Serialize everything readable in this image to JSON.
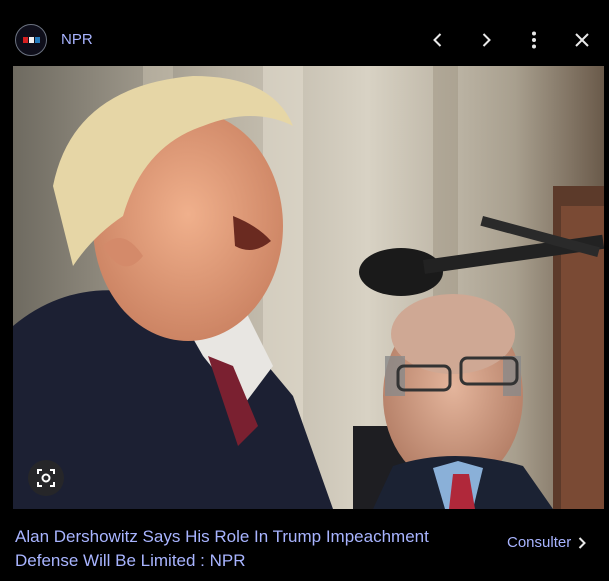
{
  "header": {
    "site_name": "NPR",
    "logo_colors": [
      "#d62021",
      "#2f2f2f",
      "#237bbd"
    ]
  },
  "image": {
    "description_icon": "photo-scene-icon"
  },
  "caption": {
    "title": "Alan Dershowitz Says His Role In Trump Impeachment Defense Will Be Limited : NPR"
  },
  "actions": {
    "visit_label": "Consulter"
  },
  "icons": {
    "prev": "chevron-left-icon",
    "next": "chevron-right-icon",
    "more": "more-vert-icon",
    "close": "close-icon",
    "lens": "lens-icon"
  },
  "colors": {
    "link": "#a8b4ff",
    "background": "#000000"
  }
}
